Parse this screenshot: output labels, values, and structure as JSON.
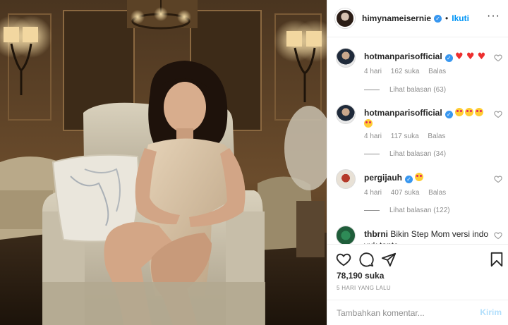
{
  "post": {
    "author": "himynameisernie",
    "follow_label": "Ikuti",
    "separator": "•",
    "more_label": "···",
    "likes_text": "78,190 suka",
    "date_text": "5 HARI YANG LALU"
  },
  "comments": [
    {
      "username": "hotmanparisofficial",
      "text": "♥ ♥ ♥",
      "time": "4 hari",
      "likes": "162 suka",
      "reply_label": "Balas",
      "view_replies": "Lihat balasan (63)"
    },
    {
      "username": "hotmanparisofficial",
      "text": "",
      "time": "4 hari",
      "likes": "117 suka",
      "reply_label": "Balas",
      "view_replies": "Lihat balasan (34)"
    },
    {
      "username": "pergijauh",
      "text": "",
      "time": "4 hari",
      "likes": "407 suka",
      "reply_label": "Balas",
      "view_replies": "Lihat balasan (122)"
    },
    {
      "username": "thbrni",
      "text": "Bikin Step Mom versi indo yuk tante"
    }
  ],
  "composer": {
    "placeholder": "Tambahkan komentar...",
    "post_label": "Kirim"
  },
  "colors": {
    "accent": "#0095f6",
    "verified": "#3897f0",
    "muted": "#8e8e8e",
    "heart": "#ed2f2f"
  },
  "icons": [
    "heart-icon",
    "comment-icon",
    "share-icon",
    "bookmark-icon",
    "verified-icon",
    "more-icon"
  ]
}
